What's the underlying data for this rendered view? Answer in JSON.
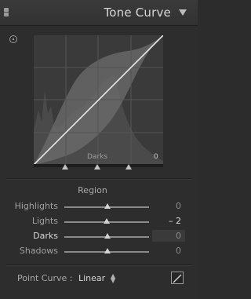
{
  "header": {
    "title": "Tone Curve"
  },
  "graph": {
    "region_label": "Darks",
    "region_value": "0"
  },
  "region": {
    "title": "Region",
    "sliders": [
      {
        "label": "Highlights",
        "value": "0",
        "position": 0.5
      },
      {
        "label": "Lights",
        "value": "– 2",
        "position": 0.49
      },
      {
        "label": "Darks",
        "value": "0",
        "position": 0.5
      },
      {
        "label": "Shadows",
        "value": "0",
        "position": 0.5
      }
    ]
  },
  "point_curve": {
    "label": "Point Curve :",
    "value": "Linear"
  },
  "colors": {
    "panel": "#2d2d2d",
    "graph": "#3a3a3a",
    "curve": "#e8e8e8"
  }
}
